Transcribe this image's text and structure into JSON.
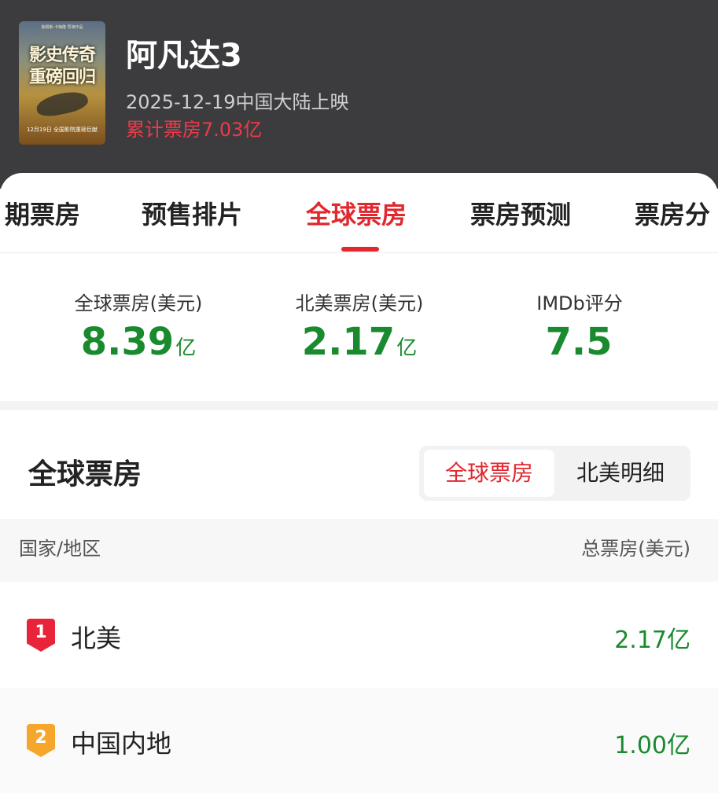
{
  "movie": {
    "title": "阿凡达3",
    "release": "2025-12-19中国大陆上映",
    "cumulative_box_office": "累计票房7.03亿",
    "poster": {
      "line1": "影史传奇",
      "line2": "重磅回归",
      "top_text": "詹姆斯·卡梅隆 导演作品",
      "date_text": "12月19日 全国影院重磅巨献"
    }
  },
  "tabs": [
    {
      "label": "期票房",
      "active": false
    },
    {
      "label": "预售排片",
      "active": false
    },
    {
      "label": "全球票房",
      "active": true
    },
    {
      "label": "票房预测",
      "active": false
    },
    {
      "label": "票房分",
      "active": false
    }
  ],
  "stats": [
    {
      "label": "全球票房(美元)",
      "value": "8.39",
      "unit": "亿"
    },
    {
      "label": "北美票房(美元)",
      "value": "2.17",
      "unit": "亿"
    },
    {
      "label": "IMDb评分",
      "value": "7.5",
      "unit": ""
    }
  ],
  "section": {
    "title": "全球票房",
    "segments": [
      {
        "label": "全球票房",
        "active": true
      },
      {
        "label": "北美明细",
        "active": false
      }
    ]
  },
  "table": {
    "headers": {
      "region": "国家/地区",
      "total": "总票房(美元)"
    },
    "rows": [
      {
        "rank": "1",
        "region": "北美",
        "total": "2.17亿"
      },
      {
        "rank": "2",
        "region": "中国内地",
        "total": "1.00亿"
      }
    ]
  },
  "colors": {
    "accent": "#e0282f",
    "value_green": "#1a8a2f",
    "header_bg": "#3c3c3e",
    "rank1": "#e8233a",
    "rank2": "#f5a72b"
  }
}
